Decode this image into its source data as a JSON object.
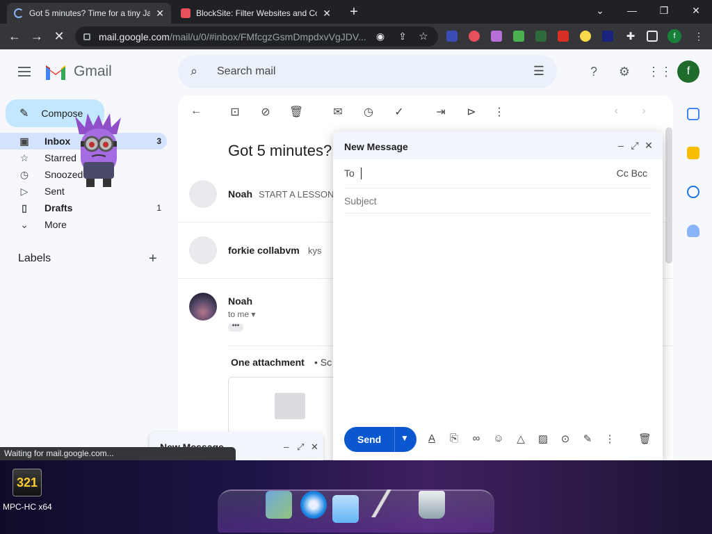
{
  "browser": {
    "tabs": [
      {
        "title": "Got 5 minutes? Time for a tiny Jap",
        "active": true
      },
      {
        "title": "BlockSite: Filter Websites and Co",
        "active": false
      }
    ],
    "url_host": "mail.google.com",
    "url_path": "/mail/u/0/#inbox/FMfcgzGsmDmpdxvVgJDV...",
    "profile_initial": "f",
    "status_text": "Waiting for mail.google.com..."
  },
  "gmail": {
    "app_name": "Gmail",
    "search_placeholder": "Search mail",
    "account_initial": "f",
    "compose_label": "Compose",
    "nav": [
      {
        "label": "Inbox",
        "count": "3",
        "icon": "inbox-icon"
      },
      {
        "label": "Starred",
        "count": "",
        "icon": "star-icon"
      },
      {
        "label": "Snoozed",
        "count": "",
        "icon": "clock-icon"
      },
      {
        "label": "Sent",
        "count": "",
        "icon": "send-icon"
      },
      {
        "label": "Drafts",
        "count": "1",
        "icon": "draft-icon"
      },
      {
        "label": "More",
        "count": "",
        "icon": "chevron-down-icon"
      }
    ],
    "labels_heading": "Labels",
    "email": {
      "subject": "Got 5 minutes?",
      "thread": [
        {
          "sender": "Noah",
          "snippet": "START A LESSON"
        },
        {
          "sender": "forkie collabvm",
          "snippet": "kys"
        },
        {
          "sender": "Noah",
          "recipient": "to me"
        }
      ],
      "attachment_heading": "One attachment",
      "attachment_meta": "• Sc"
    }
  },
  "compose_window": {
    "title": "New Message",
    "to_label": "To",
    "cc_bcc": "Cc Bcc",
    "subject_placeholder": "Subject",
    "send_label": "Send"
  },
  "minimized_compose": {
    "title": "New Message"
  },
  "desktop": {
    "app_label": "MPC-HC x64",
    "app_icon_text": "321"
  },
  "colors": {
    "chrome_dark": "#202124",
    "gmail_bg": "#f6f8fc",
    "compose_btn": "#c2e7ff",
    "send_btn": "#0b57d0",
    "inbox_active": "#d3e3fd"
  }
}
